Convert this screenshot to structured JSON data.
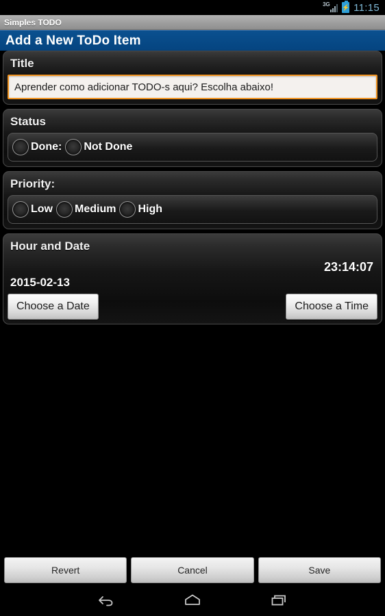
{
  "statusbar": {
    "network_label": "3G",
    "battery_icon": "battery-charging-icon",
    "signal_icon": "signal-bars-icon",
    "time": "11:15"
  },
  "appbar": {
    "app_name": "Simples TODO"
  },
  "header": {
    "title": "Add a New ToDo Item",
    "accent_color": "#07467f"
  },
  "form": {
    "title_section": {
      "label": "Title",
      "value": "Aprender como adicionar TODO-s aqui? Escolha abaixo!",
      "placeholder": "",
      "focus_border_color": "#f0921e"
    },
    "status_section": {
      "label": "Status",
      "options": [
        {
          "label": "Done:",
          "selected": false
        },
        {
          "label": "Not Done",
          "selected": false
        }
      ]
    },
    "priority_section": {
      "label": "Priority:",
      "options": [
        {
          "label": "Low",
          "selected": false
        },
        {
          "label": "Medium",
          "selected": false
        },
        {
          "label": "High",
          "selected": false
        }
      ]
    },
    "datetime_section": {
      "label": "Hour and Date",
      "time": "23:14:07",
      "date": "2015-02-13",
      "date_button": "Choose a Date",
      "time_button": "Choose a Time"
    }
  },
  "actions": {
    "revert": "Revert",
    "cancel": "Cancel",
    "save": "Save"
  },
  "navbar": {
    "back": "back-icon",
    "home": "home-icon",
    "recents": "recents-icon"
  }
}
